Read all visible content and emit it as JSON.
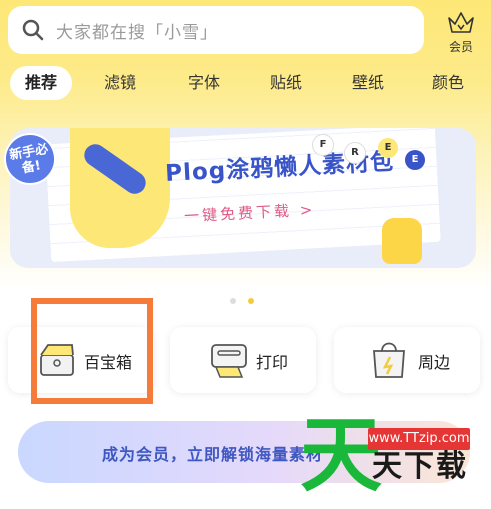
{
  "search": {
    "placeholder": "大家都在搜「小雪」"
  },
  "vip": {
    "label": "会员"
  },
  "tabs": [
    {
      "label": "推荐",
      "active": true
    },
    {
      "label": "滤镜"
    },
    {
      "label": "字体"
    },
    {
      "label": "贴纸"
    },
    {
      "label": "壁纸"
    },
    {
      "label": "颜色"
    }
  ],
  "banner": {
    "badge": "新手必备!",
    "title": "Plog涂鸦懒人素材包",
    "subtitle": "一键免费下载 >",
    "letters": [
      "F",
      "R",
      "E",
      "E"
    ]
  },
  "cards": [
    {
      "label": "百宝箱",
      "icon": "treasure-box-icon"
    },
    {
      "label": "打印",
      "icon": "printer-icon"
    },
    {
      "label": "周边",
      "icon": "shopping-bag-icon"
    }
  ],
  "member": {
    "label": "成为会员，立即解锁海量素材"
  },
  "watermark": {
    "big": "天",
    "url": "www.TTzip.com",
    "text": "天下载"
  },
  "colors": {
    "accent": "#fde776",
    "highlight": "#f47b3a",
    "brand_blue": "#3854c8"
  }
}
